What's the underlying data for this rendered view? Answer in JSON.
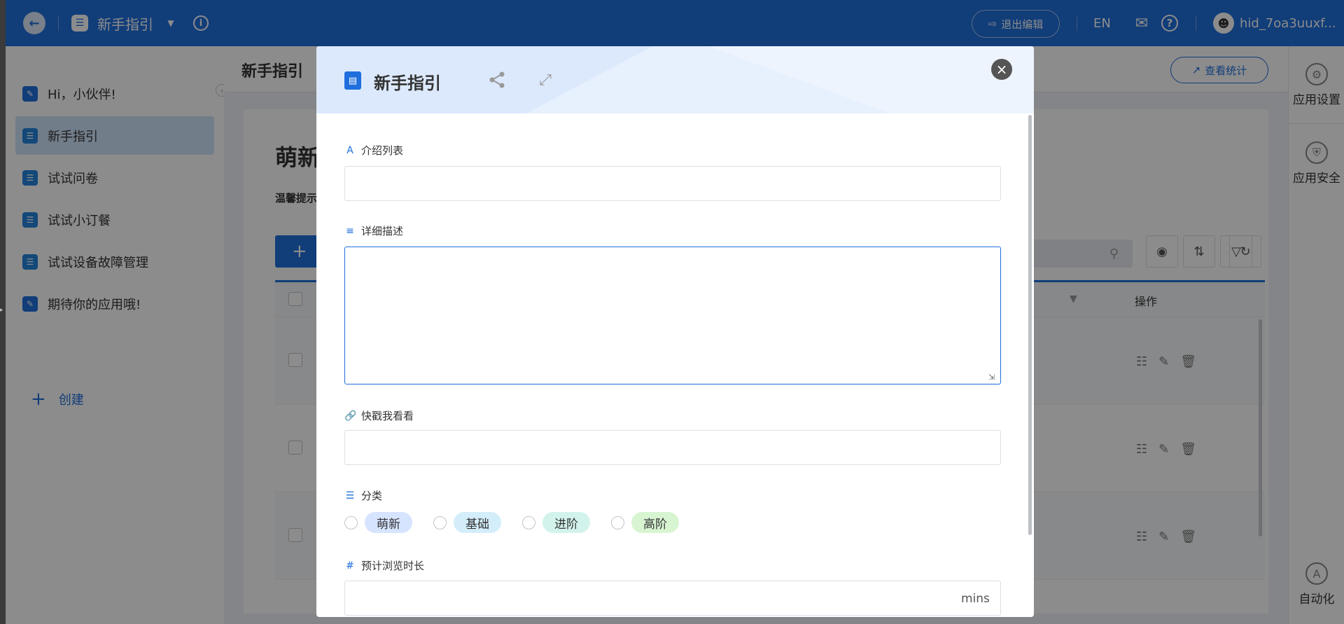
{
  "topbar": {
    "app_title": "新手指引",
    "exit_edit": "退出编辑",
    "lang": "EN",
    "username": "hid_7oa3uuxf..."
  },
  "sidebar": {
    "items": [
      {
        "label": "Hi，小伙伴!",
        "icon": "edit-icon"
      },
      {
        "label": "新手指引",
        "icon": "list-icon",
        "active": true
      },
      {
        "label": "试试问卷",
        "icon": "list-icon"
      },
      {
        "label": "试试小订餐",
        "icon": "list-icon"
      },
      {
        "label": "试试设备故障管理",
        "icon": "list-icon"
      },
      {
        "label": "期待你的应用哦!",
        "icon": "edit-icon"
      }
    ],
    "create": "创建"
  },
  "main": {
    "title": "新手指引",
    "stats_button": "查看统计",
    "card_title": "萌新",
    "tip": "温馨提示",
    "ops_header": "操作"
  },
  "right_panel": {
    "settings": "应用设置",
    "security": "应用安全",
    "automation": "自动化"
  },
  "modal": {
    "title": "新手指引",
    "fields": {
      "intro_list": {
        "label": "介绍列表",
        "value": ""
      },
      "detail": {
        "label": "详细描述",
        "value": ""
      },
      "quick_link": {
        "label": "快戳我看看",
        "value": ""
      },
      "category": {
        "label": "分类",
        "options": [
          {
            "label": "萌新",
            "color": "#d6e4ff"
          },
          {
            "label": "基础",
            "color": "#d3eefa"
          },
          {
            "label": "进阶",
            "color": "#d2f3ec"
          },
          {
            "label": "高阶",
            "color": "#d8f5d2"
          }
        ]
      },
      "duration": {
        "label": "预计浏览时长",
        "value": "",
        "unit": "mins"
      }
    }
  },
  "colors": {
    "brand": "#1f6fdc",
    "overlay": "rgba(0,0,0,0.45)"
  }
}
